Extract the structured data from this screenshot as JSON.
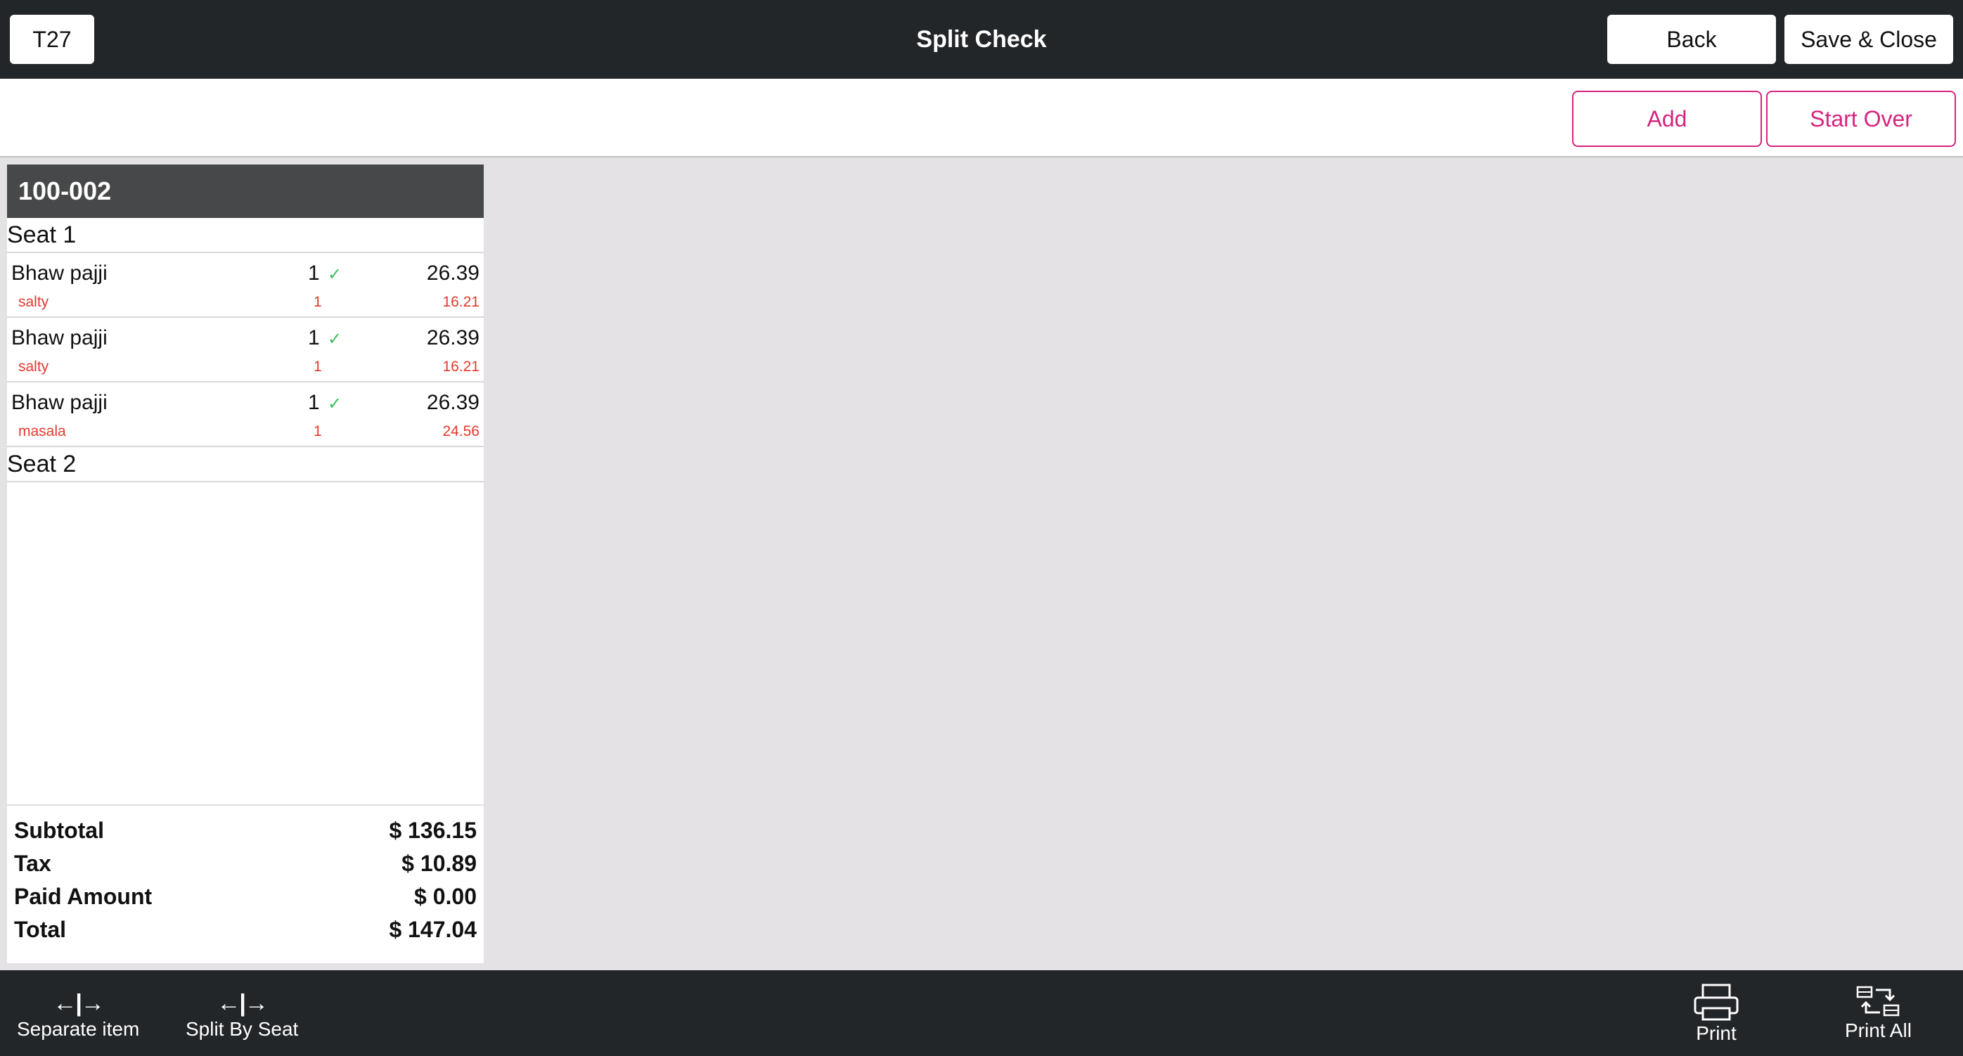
{
  "header": {
    "table_button": "T27",
    "title": "Split Check",
    "back_label": "Back",
    "save_close_label": "Save & Close"
  },
  "actions": {
    "add_label": "Add",
    "start_over_label": "Start Over"
  },
  "check": {
    "id": "100-002",
    "seats": [
      {
        "label": "Seat 1",
        "items": [
          {
            "name": "Bhaw pajji",
            "qty": "1",
            "price": "26.39",
            "mod_name": "salty",
            "mod_qty": "1",
            "mod_price": "16.21"
          },
          {
            "name": "Bhaw pajji",
            "qty": "1",
            "price": "26.39",
            "mod_name": "salty",
            "mod_qty": "1",
            "mod_price": "16.21"
          },
          {
            "name": "Bhaw pajji",
            "qty": "1",
            "price": "26.39",
            "mod_name": "masala",
            "mod_qty": "1",
            "mod_price": "24.56"
          }
        ]
      },
      {
        "label": "Seat 2",
        "items": []
      }
    ],
    "totals": {
      "subtotal_label": "Subtotal",
      "subtotal": "$ 136.15",
      "tax_label": "Tax",
      "tax": "$ 10.89",
      "paid_label": "Paid Amount",
      "paid": "$ 0.00",
      "total_label": "Total",
      "total": "$ 147.04"
    }
  },
  "toolbar": {
    "separate_label": "Separate item",
    "split_seat_label": "Split By Seat",
    "print_label": "Print",
    "print_all_label": "Print All"
  },
  "colors": {
    "accent": "#d6247d",
    "bar": "#232629",
    "modifier": "#e23a2e",
    "check": "#3cbf5a"
  }
}
